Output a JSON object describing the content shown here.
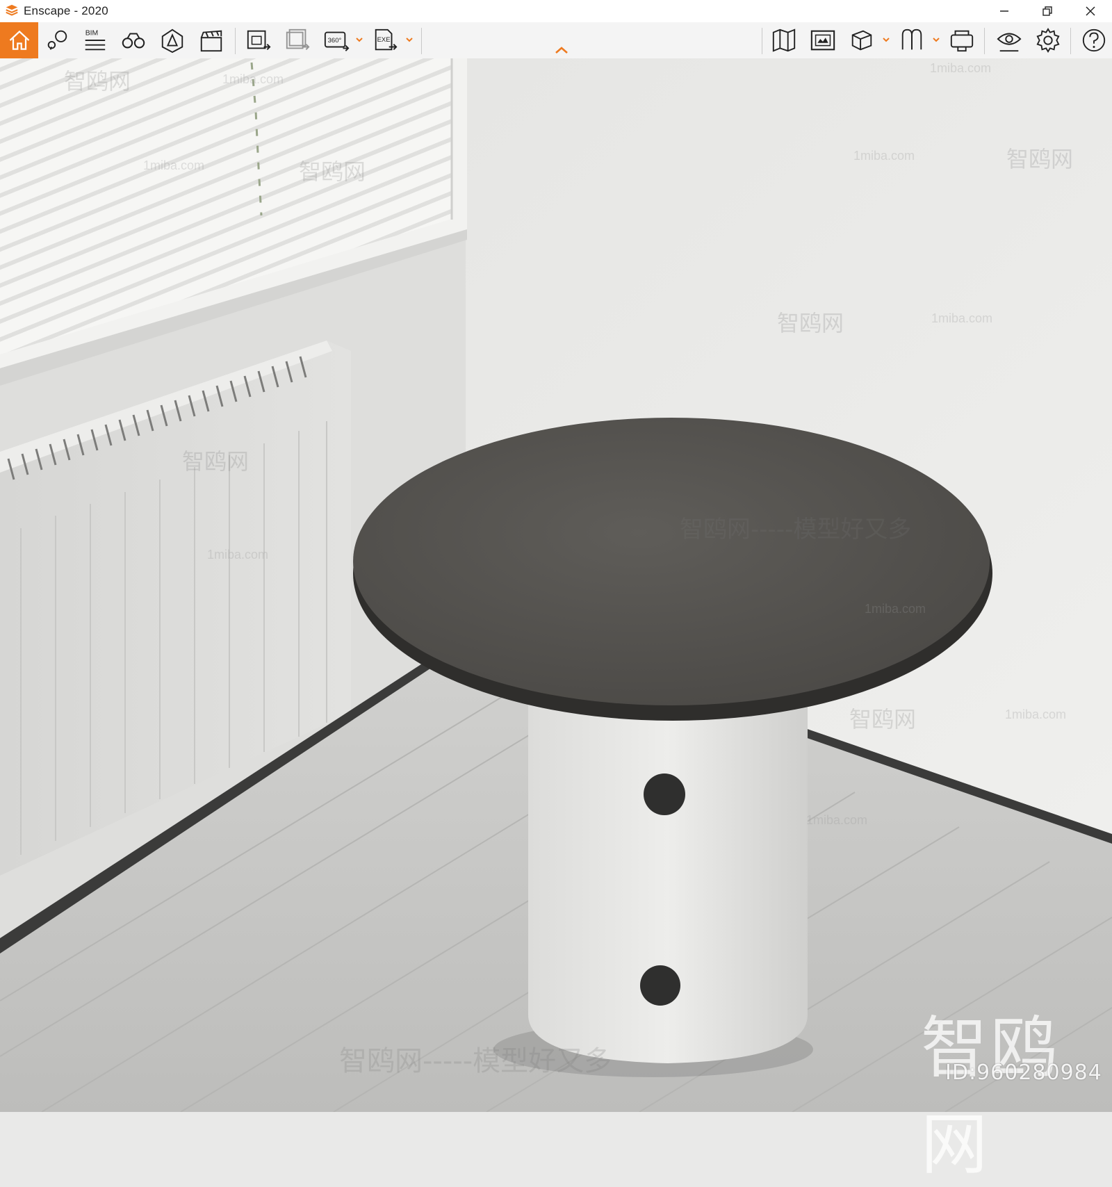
{
  "window": {
    "title": "Enscape - 2020",
    "accent_color": "#ee7a1f"
  },
  "toolbar": {
    "items": [
      {
        "icon": "home-icon"
      },
      {
        "icon": "views-icon"
      },
      {
        "icon": "bim-icon",
        "label": "BIM"
      },
      {
        "icon": "binoculars-icon"
      },
      {
        "icon": "assets-icon"
      },
      {
        "icon": "clapperboard-icon"
      },
      {
        "icon": "screenshot-export-icon"
      },
      {
        "icon": "batch-render-icon"
      },
      {
        "icon": "panorama-export-icon",
        "label": "360°"
      },
      {
        "icon": "exe-export-icon",
        "label": "EXE"
      },
      {
        "icon": "map-icon"
      },
      {
        "icon": "capture-icon"
      },
      {
        "icon": "cube-icon"
      },
      {
        "icon": "pointcloud-icon"
      },
      {
        "icon": "vr-headset-icon"
      },
      {
        "icon": "visual-settings-icon"
      },
      {
        "icon": "settings-gear-icon"
      },
      {
        "icon": "help-icon"
      }
    ]
  },
  "watermarks": {
    "brand": "智鸥网",
    "slogan": "智鸥网-----模型好又多",
    "site": "1miba.com",
    "id_text": "ID:960280984"
  }
}
